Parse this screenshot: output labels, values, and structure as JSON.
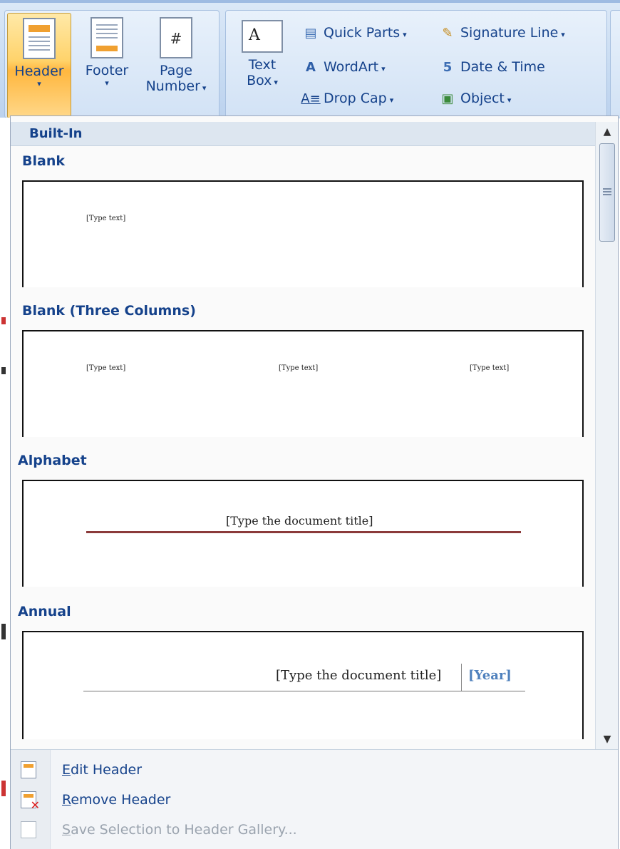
{
  "ribbon": {
    "header": {
      "label": "Header",
      "dropdown": "▾"
    },
    "footer": {
      "label": "Footer",
      "dropdown": "▾"
    },
    "page_number": {
      "line1": "Page",
      "line2": "Number",
      "dropdown": "▾"
    },
    "text_box": {
      "line1": "Text",
      "line2": "Box",
      "dropdown": "▾"
    },
    "quick_parts": {
      "label": "Quick Parts",
      "dropdown": "▾"
    },
    "wordart": {
      "label": "WordArt",
      "dropdown": "▾"
    },
    "drop_cap": {
      "label": "Drop Cap",
      "dropdown": "▾"
    },
    "signature_line": {
      "label": "Signature Line",
      "dropdown": "▾"
    },
    "date_time": {
      "label": "Date & Time"
    },
    "object": {
      "label": "Object",
      "dropdown": "▾"
    }
  },
  "gallery": {
    "section": "Built-In",
    "items": [
      {
        "title": "Blank",
        "texts": [
          "[Type text]"
        ]
      },
      {
        "title": "Blank (Three Columns)",
        "texts": [
          "[Type text]",
          "[Type text]",
          "[Type text]"
        ]
      },
      {
        "title": "Alphabet",
        "texts": [
          "[Type the document title]"
        ]
      },
      {
        "title": "Annual",
        "texts": [
          "[Type the document title]",
          "[Year]"
        ]
      }
    ]
  },
  "commands": {
    "edit": {
      "accel": "E",
      "rest": "dit Header"
    },
    "remove": {
      "accel": "R",
      "rest": "emove Header"
    },
    "save": {
      "accel": "S",
      "rest": "ave Selection to Header Gallery..."
    }
  },
  "colors": {
    "accent": "#15428b",
    "alphabet_rule": "#8b3a3a",
    "annual_year": "#4f81bd",
    "highlight": "#ffd36b"
  }
}
